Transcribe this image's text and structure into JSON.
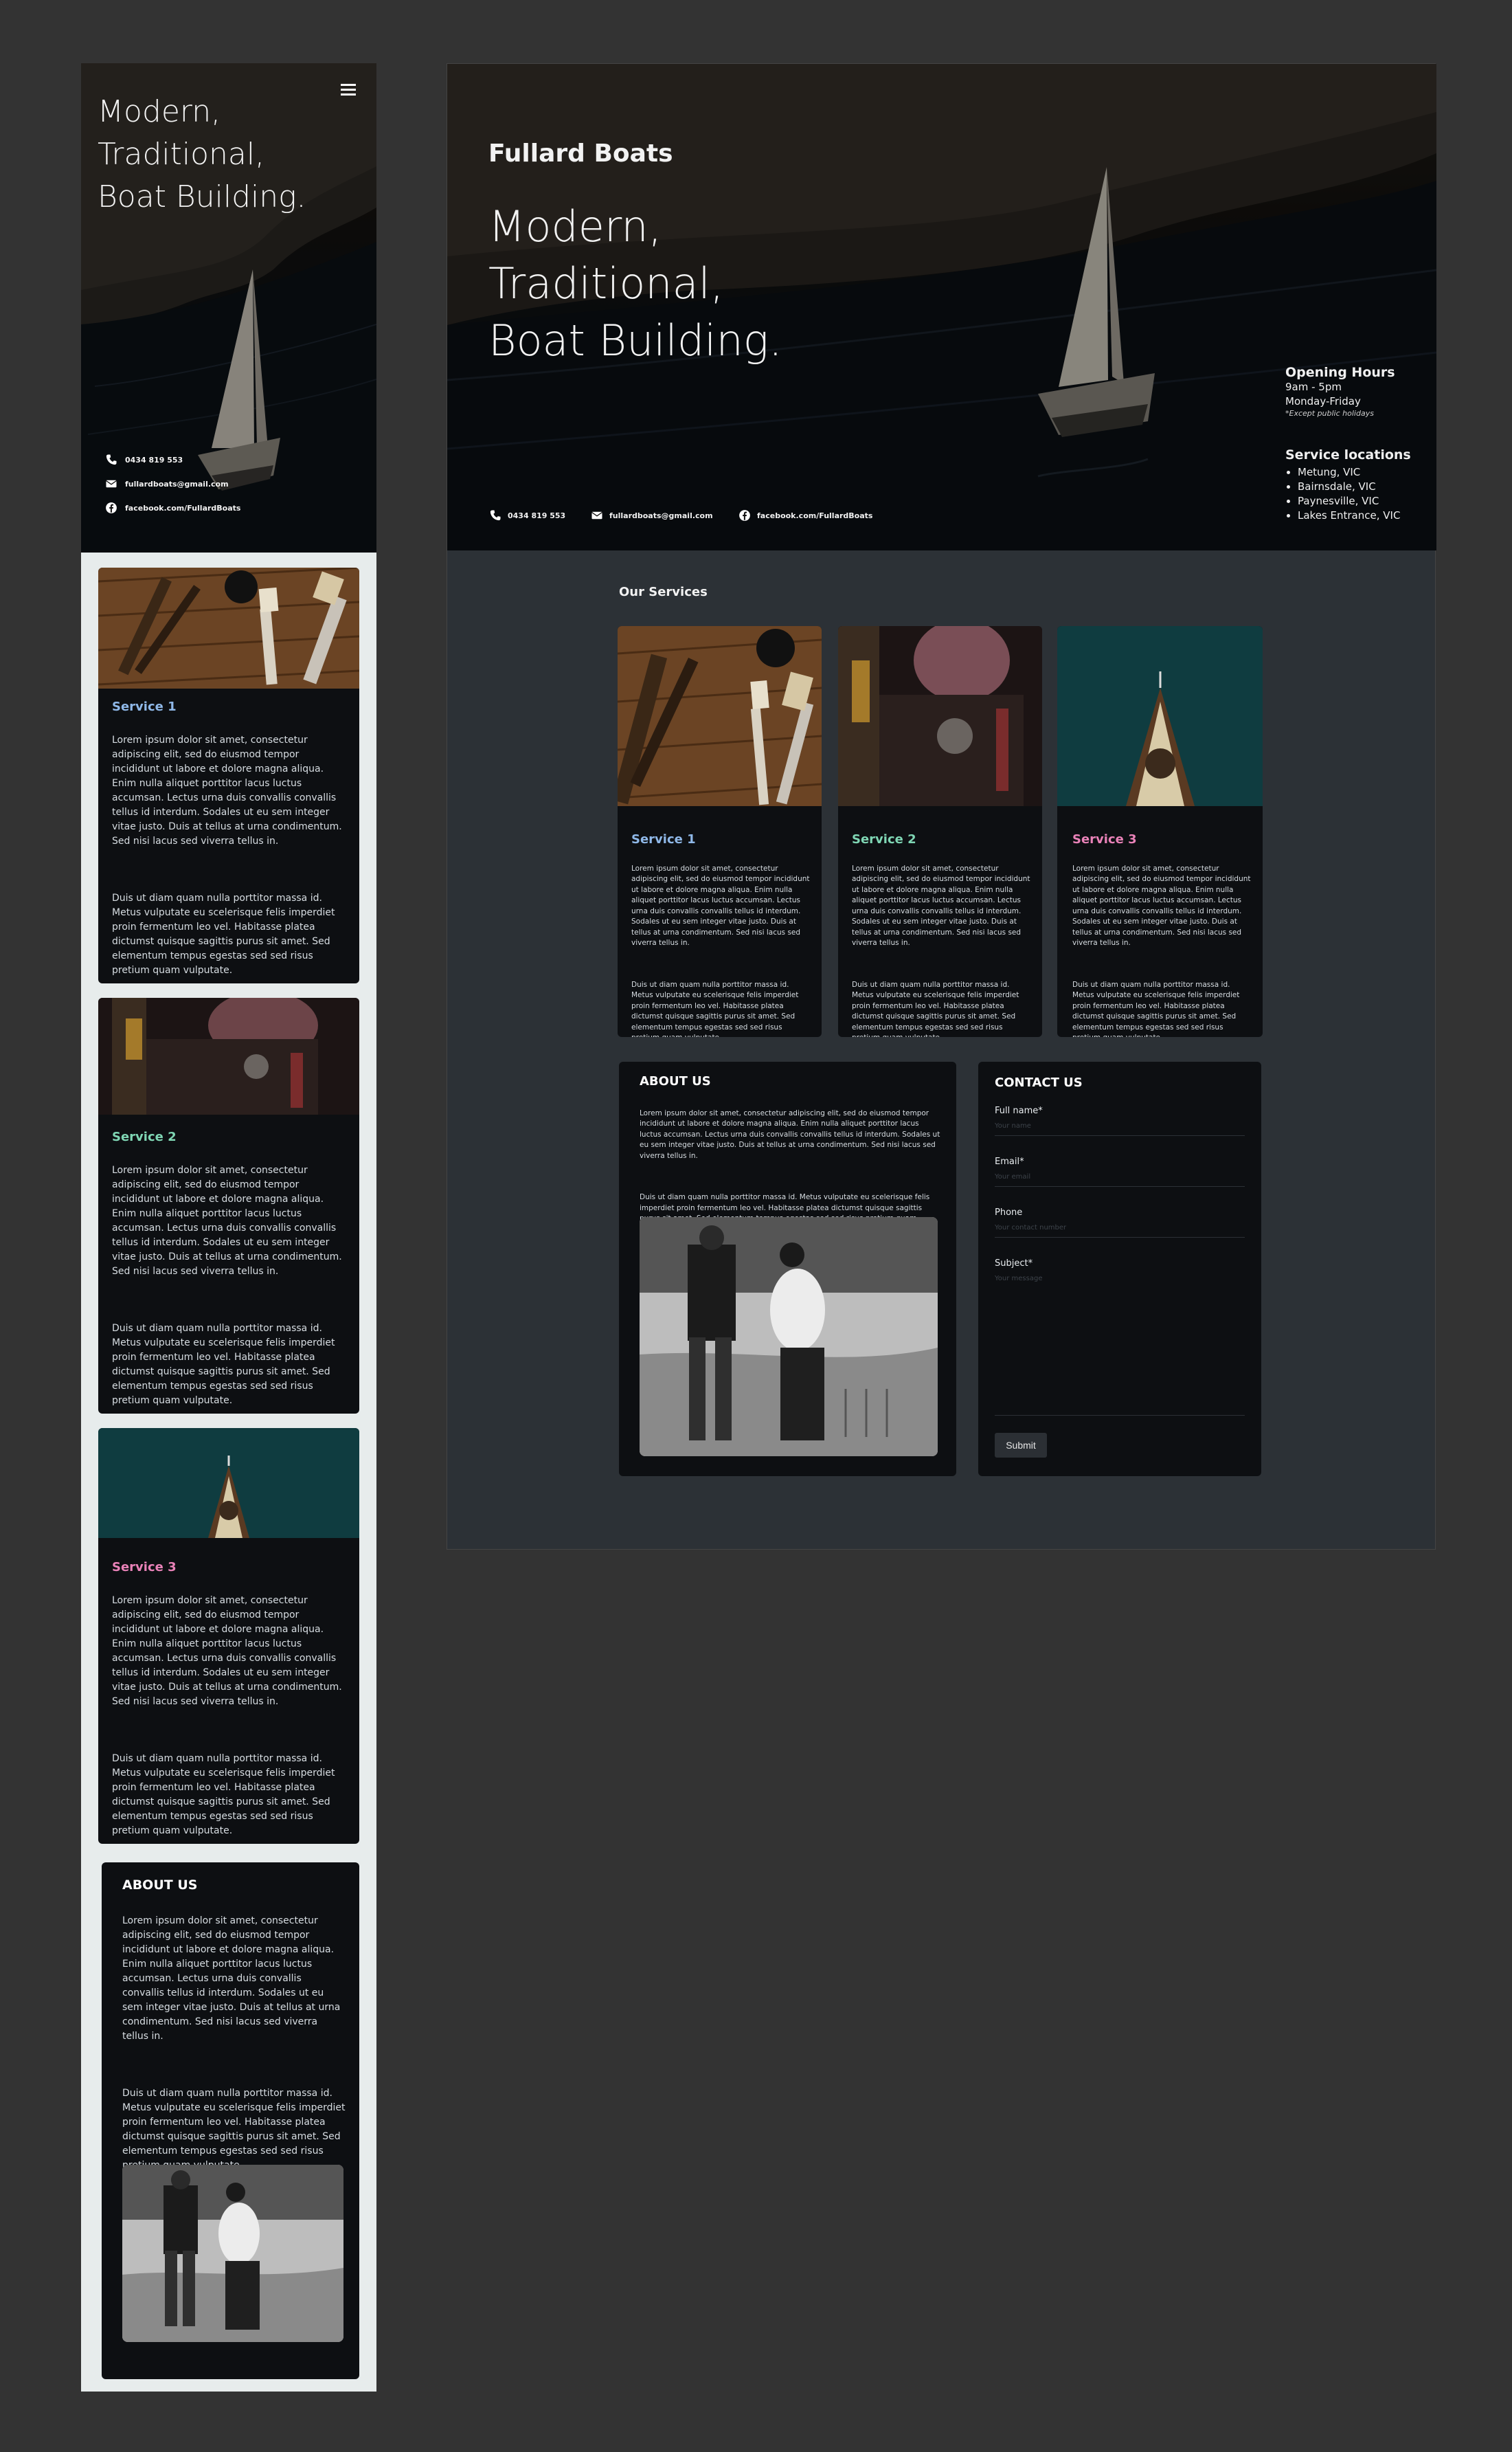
{
  "brand": "Fullard Boats",
  "hero": {
    "title_lines": [
      "Modern,",
      "Traditional,",
      "Boat Building."
    ]
  },
  "contact": {
    "phone": "0434 819 553",
    "email": "fullardboats@gmail.com",
    "facebook": "facebook.com/FullardBoats"
  },
  "opening_hours": {
    "heading": "Opening Hours",
    "time": "9am - 5pm",
    "days": "Monday-Friday",
    "note": "*Except public holidays"
  },
  "service_locations": {
    "heading": "Service locations",
    "items": [
      "Metung, VIC",
      "Bairnsdale, VIC",
      "Paynesville, VIC",
      "Lakes Entrance, VIC"
    ]
  },
  "services_heading": "Our Services",
  "services": [
    {
      "title": "Service 1",
      "color": "#8fb8e8",
      "p1": "Lorem ipsum dolor sit amet, consectetur adipiscing elit, sed do eiusmod tempor incididunt ut labore et dolore magna aliqua. Enim nulla aliquet porttitor lacus luctus accumsan. Lectus urna duis convallis convallis tellus id interdum. Sodales ut eu sem integer vitae justo. Duis at tellus at urna condimentum. Sed nisi lacus sed viverra tellus in.",
      "p2": "Duis ut diam quam nulla porttitor massa id. Metus vulputate eu scelerisque felis imperdiet proin fermentum leo vel. Habitasse platea dictumst quisque sagittis purus sit amet. Sed elementum tempus egestas sed sed risus pretium quam vulputate."
    },
    {
      "title": "Service 2",
      "color": "#7fd6b4",
      "p1": "Lorem ipsum dolor sit amet, consectetur adipiscing elit, sed do eiusmod tempor incididunt ut labore et dolore magna aliqua. Enim nulla aliquet porttitor lacus luctus accumsan. Lectus urna duis convallis convallis tellus id interdum. Sodales ut eu sem integer vitae justo. Duis at tellus at urna condimentum. Sed nisi lacus sed viverra tellus in.",
      "p2": "Duis ut diam quam nulla porttitor massa id. Metus vulputate eu scelerisque felis imperdiet proin fermentum leo vel. Habitasse platea dictumst quisque sagittis purus sit amet. Sed elementum tempus egestas sed sed risus pretium quam vulputate."
    },
    {
      "title": "Service 3",
      "color": "#e982b8",
      "p1": "Lorem ipsum dolor sit amet, consectetur adipiscing elit, sed do eiusmod tempor incididunt ut labore et dolore magna aliqua. Enim nulla aliquet porttitor lacus luctus accumsan. Lectus urna duis convallis convallis tellus id interdum. Sodales ut eu sem integer vitae justo. Duis at tellus at urna condimentum. Sed nisi lacus sed viverra tellus in.",
      "p2": "Duis ut diam quam nulla porttitor massa id. Metus vulputate eu scelerisque felis imperdiet proin fermentum leo vel. Habitasse platea dictumst quisque sagittis purus sit amet. Sed elementum tempus egestas sed sed risus pretium quam vulputate."
    }
  ],
  "about": {
    "heading": "ABOUT US",
    "p1": "Lorem ipsum dolor sit amet, consectetur adipiscing elit, sed do eiusmod tempor incididunt ut labore et dolore magna aliqua. Enim nulla aliquet porttitor lacus luctus accumsan. Lectus urna duis convallis convallis tellus id interdum. Sodales ut eu sem integer vitae justo. Duis at tellus at urna condimentum. Sed nisi lacus sed viverra tellus in.",
    "p2": "Duis ut diam quam nulla porttitor massa id. Metus vulputate eu scelerisque felis imperdiet proin fermentum leo vel. Habitasse platea dictumst quisque sagittis purus sit amet. Sed elementum tempus egestas sed sed risus pretium quam vulputate."
  },
  "contact_form": {
    "heading": "CONTACT US",
    "fields": [
      {
        "label": "Full name*",
        "placeholder": "Your name"
      },
      {
        "label": "Email*",
        "placeholder": "Your email"
      },
      {
        "label": "Phone",
        "placeholder": "Your contact number"
      },
      {
        "label": "Subject*",
        "placeholder": "Your message"
      }
    ],
    "submit": "Submit"
  },
  "colors": {
    "page_bg": "#333333",
    "card_bg": "#0d0f12",
    "desktop_section_bg": "#2c3136",
    "mobile_bg": "#e7ecec"
  }
}
